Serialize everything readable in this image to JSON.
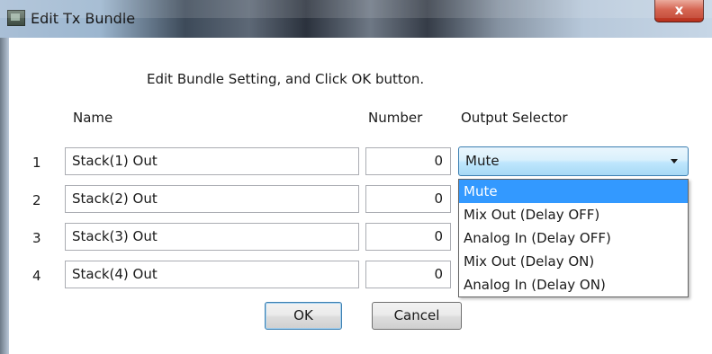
{
  "window": {
    "title": "Edit Tx Bundle",
    "close_label": "x"
  },
  "dialog": {
    "instruction": "Edit Bundle Setting, and Click OK button.",
    "headers": {
      "name": "Name",
      "number": "Number",
      "output": "Output Selector"
    },
    "rows": [
      {
        "index": "1",
        "name": "Stack(1) Out",
        "number": "0"
      },
      {
        "index": "2",
        "name": "Stack(2) Out",
        "number": "0"
      },
      {
        "index": "3",
        "name": "Stack(3) Out",
        "number": "0"
      },
      {
        "index": "4",
        "name": "Stack(4) Out",
        "number": "0"
      }
    ],
    "output_selector": {
      "value": "Mute",
      "options": [
        "Mute",
        "Mix Out (Delay OFF)",
        "Analog In (Delay OFF)",
        "Mix Out (Delay ON)",
        "Analog In (Delay ON)"
      ],
      "highlight_color": "#3399ff"
    },
    "buttons": {
      "ok": "OK",
      "cancel": "Cancel"
    }
  }
}
